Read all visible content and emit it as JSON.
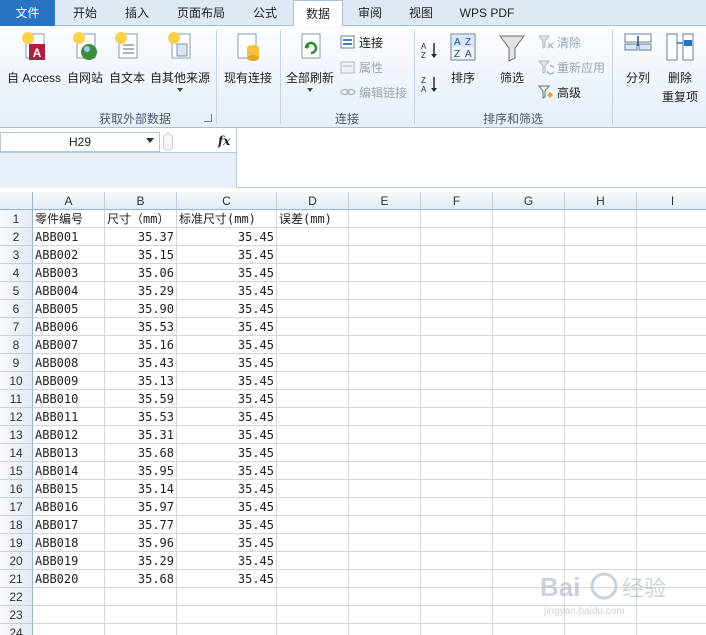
{
  "tabs": [
    {
      "label": "文件"
    },
    {
      "label": "开始"
    },
    {
      "label": "插入"
    },
    {
      "label": "页面布局"
    },
    {
      "label": "公式"
    },
    {
      "label": "数据"
    },
    {
      "label": "审阅"
    },
    {
      "label": "视图"
    },
    {
      "label": "WPS PDF"
    }
  ],
  "ribbon": {
    "get_external": {
      "access": "自 Access",
      "web": "自网站",
      "text": "自文本",
      "other": "自其他来源",
      "existing": "现有连接",
      "group_label": "获取外部数据"
    },
    "connections": {
      "refresh_all": "全部刷新",
      "connections": "连接",
      "properties": "属性",
      "edit_links": "编辑链接",
      "group_label": "连接"
    },
    "sort_filter": {
      "sort": "排序",
      "filter": "筛选",
      "clear": "清除",
      "reapply": "重新应用",
      "advanced": "高级",
      "group_label": "排序和筛选"
    },
    "data_tools": {
      "split": "分列",
      "remove": "删除",
      "remove2": "重复项"
    }
  },
  "formula_bar": {
    "name_box": "H29",
    "fx": "fx",
    "content": ""
  },
  "sheet": {
    "columns": [
      "A",
      "B",
      "C",
      "D",
      "E",
      "F",
      "G",
      "H",
      "I"
    ],
    "rows": [
      [
        "零件编号",
        "尺寸（mm）",
        "标准尺寸(mm)",
        "误差(mm)"
      ],
      [
        "ABB001",
        "35.37",
        "35.45",
        ""
      ],
      [
        "ABB002",
        "35.15",
        "35.45",
        ""
      ],
      [
        "ABB003",
        "35.06",
        "35.45",
        ""
      ],
      [
        "ABB004",
        "35.29",
        "35.45",
        ""
      ],
      [
        "ABB005",
        "35.90",
        "35.45",
        ""
      ],
      [
        "ABB006",
        "35.53",
        "35.45",
        ""
      ],
      [
        "ABB007",
        "35.16",
        "35.45",
        ""
      ],
      [
        "ABB008",
        "35.43",
        "35.45",
        ""
      ],
      [
        "ABB009",
        "35.13",
        "35.45",
        ""
      ],
      [
        "ABB010",
        "35.59",
        "35.45",
        ""
      ],
      [
        "ABB011",
        "35.53",
        "35.45",
        ""
      ],
      [
        "ABB012",
        "35.31",
        "35.45",
        ""
      ],
      [
        "ABB013",
        "35.68",
        "35.45",
        ""
      ],
      [
        "ABB014",
        "35.95",
        "35.45",
        ""
      ],
      [
        "ABB015",
        "35.14",
        "35.45",
        ""
      ],
      [
        "ABB016",
        "35.97",
        "35.45",
        ""
      ],
      [
        "ABB017",
        "35.77",
        "35.45",
        ""
      ],
      [
        "ABB018",
        "35.96",
        "35.45",
        ""
      ],
      [
        "ABB019",
        "35.29",
        "35.45",
        ""
      ],
      [
        "ABB020",
        "35.68",
        "35.45",
        ""
      ],
      [
        "",
        "",
        "",
        ""
      ],
      [
        "",
        "",
        "",
        ""
      ],
      [
        "",
        "",
        "",
        ""
      ]
    ]
  },
  "watermark": {
    "text": "Bai百 经验",
    "url": "jingyan.baidu.com"
  },
  "colors": {
    "file_tab": "#2a72c2",
    "ribbon_bg": "#e6eef8"
  }
}
